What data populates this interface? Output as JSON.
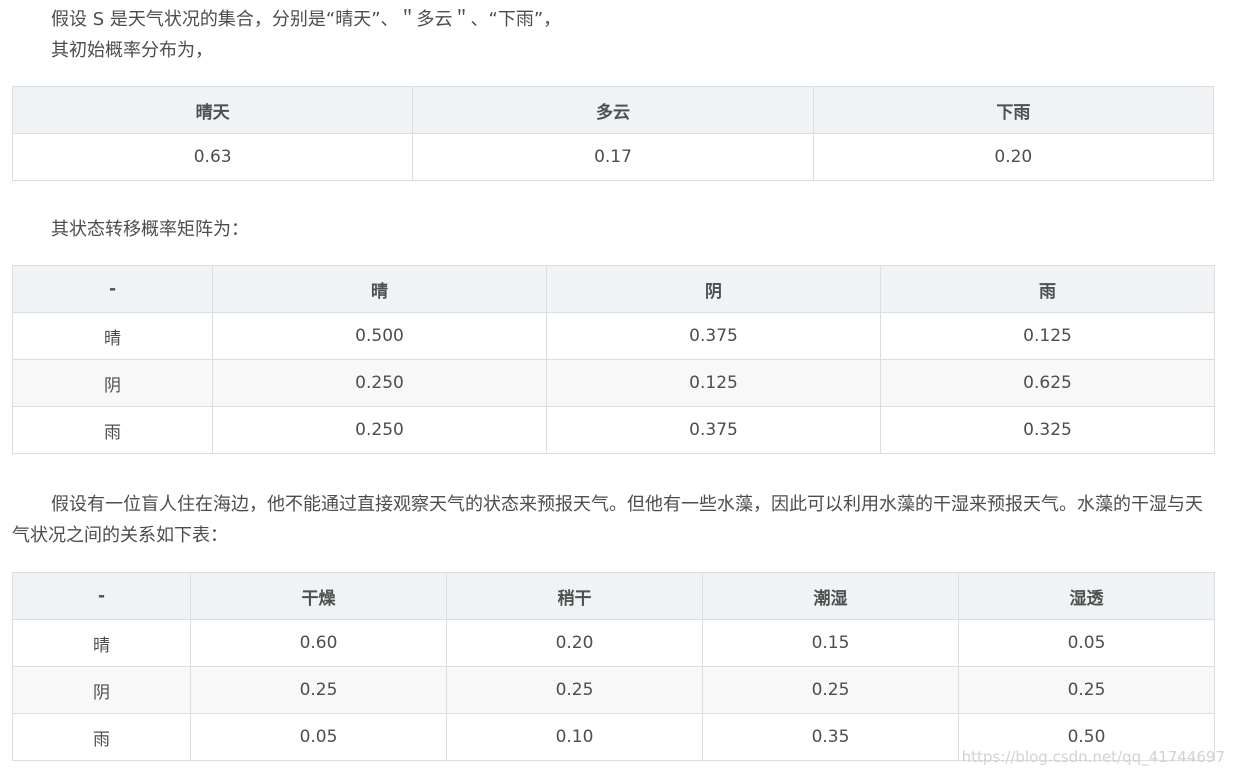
{
  "intro": {
    "line1": "假设 S 是天气状况的集合，分别是“晴天”、＂多云＂、“下雨”，",
    "line2": "其初始概率分布为，"
  },
  "initial_table": {
    "headers": [
      "晴天",
      "多云",
      "下雨"
    ],
    "values": [
      "0.63",
      "0.17",
      "0.20"
    ]
  },
  "transition_intro": "其状态转移概率矩阵为：",
  "transition_table": {
    "headers": [
      "-",
      "晴",
      "阴",
      "雨"
    ],
    "rows": [
      [
        "晴",
        "0.500",
        "0.375",
        "0.125"
      ],
      [
        "阴",
        "0.250",
        "0.125",
        "0.625"
      ],
      [
        "雨",
        "0.250",
        "0.375",
        "0.325"
      ]
    ]
  },
  "seaweed_intro": "假设有一位盲人住在海边，他不能通过直接观察天气的状态来预报天气。但他有一些水藻，因此可以利用水藻的干湿来预报天气。水藻的干湿与天气状况之间的关系如下表：",
  "emission_table": {
    "headers": [
      "-",
      "干燥",
      "稍干",
      "潮湿",
      "湿透"
    ],
    "rows": [
      [
        "晴",
        "0.60",
        "0.20",
        "0.15",
        "0.05"
      ],
      [
        "阴",
        "0.25",
        "0.25",
        "0.25",
        "0.25"
      ],
      [
        "雨",
        "0.05",
        "0.10",
        "0.35",
        "0.50"
      ]
    ]
  },
  "watermark": "https://blog.csdn.net/qq_41744697"
}
